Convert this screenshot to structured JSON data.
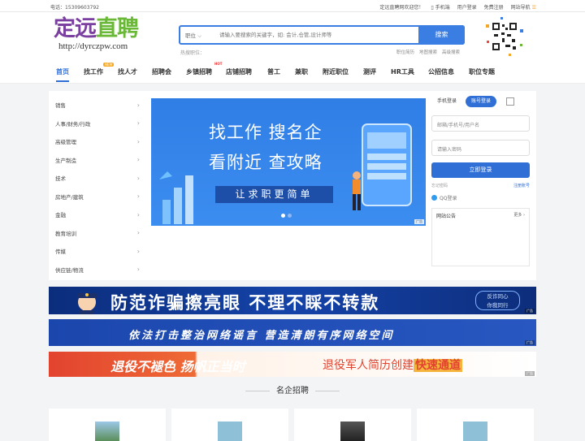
{
  "topbar": {
    "phone": "电话：15309603792",
    "welcome": "定远直聘网欢迎您！",
    "mobile": "手机端",
    "user_login": "用户登录",
    "register": "免费注册",
    "site_nav": "网站导航"
  },
  "logo": {
    "part1": "定远",
    "part2": "直聘",
    "url": "http://dyrczpw.com"
  },
  "search": {
    "type": "职位",
    "placeholder": "请输入要搜索的关键字，如: 会计,仓管,设计师等",
    "button": "搜索",
    "hot_label": "热搜职位：",
    "links": [
      "职位简历",
      "地图搜索",
      "高级搜索"
    ]
  },
  "nav": {
    "items": [
      "首页",
      "找工作",
      "找人才",
      "招聘会",
      "乡镇招聘",
      "店铺招聘",
      "普工",
      "兼职",
      "附近职位",
      "测评",
      "HR工具",
      "公招信息",
      "职位专题"
    ],
    "new_badge": "NEW",
    "hot_badge": "HOT"
  },
  "categories": [
    "销售",
    "人事/财务/行政",
    "高级管理",
    "生产制造",
    "技术",
    "房地产/建筑",
    "金融",
    "教育培训",
    "传媒",
    "供应链/物流"
  ],
  "banner": {
    "line1": "找工作   搜名企",
    "line2": "看附近   查攻略",
    "slogan": "让求职更简单",
    "ad": "广告"
  },
  "login": {
    "tab_mobile": "手机登录",
    "tab_account": "账号登录",
    "user_placeholder": "邮箱/手机号/用户名",
    "pwd_placeholder": "请输入密码",
    "submit": "立即登录",
    "forgot": "忘记密码",
    "register": "注册账号",
    "qq": "QQ登录",
    "notice_title": "网站公告",
    "more": "更多"
  },
  "ads": {
    "s1_text": "防范诈骗擦亮眼  不理不睬不转款",
    "s1_badge": [
      "反诈同心",
      "你我同行"
    ],
    "s2_text": "依法打击整治网络谣言   营造清朗有序网络空间",
    "s3_text1": "退役不褪色  扬帆正当时",
    "s3_text2a": "退役军人简历创建",
    "s3_text2b": "快速通道",
    "tag": "广告"
  },
  "section": {
    "title": "名企招聘"
  },
  "colors": {
    "brand_blue": "#2f6fd6",
    "logo_purple": "#7b3fa0",
    "logo_green": "#69b936"
  }
}
